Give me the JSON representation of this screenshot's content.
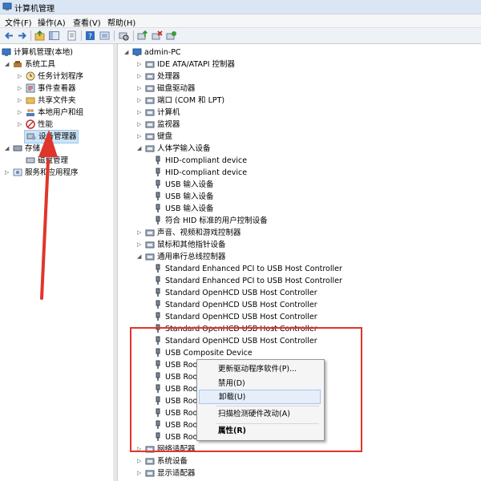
{
  "window": {
    "title": "计算机管理"
  },
  "menu": {
    "file": "文件(F)",
    "action": "操作(A)",
    "view": "查看(V)",
    "help": "帮助(H)"
  },
  "left_tree": {
    "root": "计算机管理(本地)",
    "system_tools": "系统工具",
    "task_scheduler": "任务计划程序",
    "event_viewer": "事件查看器",
    "shared_folders": "共享文件夹",
    "local_users": "本地用户和组",
    "performance": "性能",
    "device_manager": "设备管理器",
    "storage": "存储",
    "disk_mgmt": "磁盘管理",
    "services": "服务和应用程序"
  },
  "device_tree": {
    "computer_name": "admin-PC",
    "items": [
      "IDE ATA/ATAPI 控制器",
      "处理器",
      "磁盘驱动器",
      "端口 (COM 和 LPT)",
      "计算机",
      "监视器",
      "键盘",
      "人体学输入设备",
      "HID-compliant device",
      "HID-compliant device",
      "USB 输入设备",
      "USB 输入设备",
      "USB 输入设备",
      "符合 HID 标准的用户控制设备",
      "声音、视频和游戏控制器",
      "鼠标和其他指针设备",
      "通用串行总线控制器",
      "Standard Enhanced PCI to USB Host Controller",
      "Standard Enhanced PCI to USB Host Controller",
      "Standard OpenHCD USB Host Controller",
      "Standard OpenHCD USB Host Controller",
      "Standard OpenHCD USB Host Controller",
      "Standard OpenHCD USB Host Controller",
      "Standard OpenHCD USB Host Controller",
      "USB Composite Device",
      "USB Roo",
      "USB Roo",
      "USB Roo",
      "USB Roo",
      "USB Roo",
      "USB Roo",
      "USB Roo",
      "网络适配器",
      "系统设备",
      "显示适配器"
    ]
  },
  "context_menu": {
    "update_driver": "更新驱动程序软件(P)...",
    "disable": "禁用(D)",
    "uninstall": "卸载(U)",
    "scan": "扫描检测硬件改动(A)",
    "properties": "属性(R)"
  },
  "colors": {
    "annotation_red": "#e0352b",
    "selection": "#cce4f7"
  }
}
